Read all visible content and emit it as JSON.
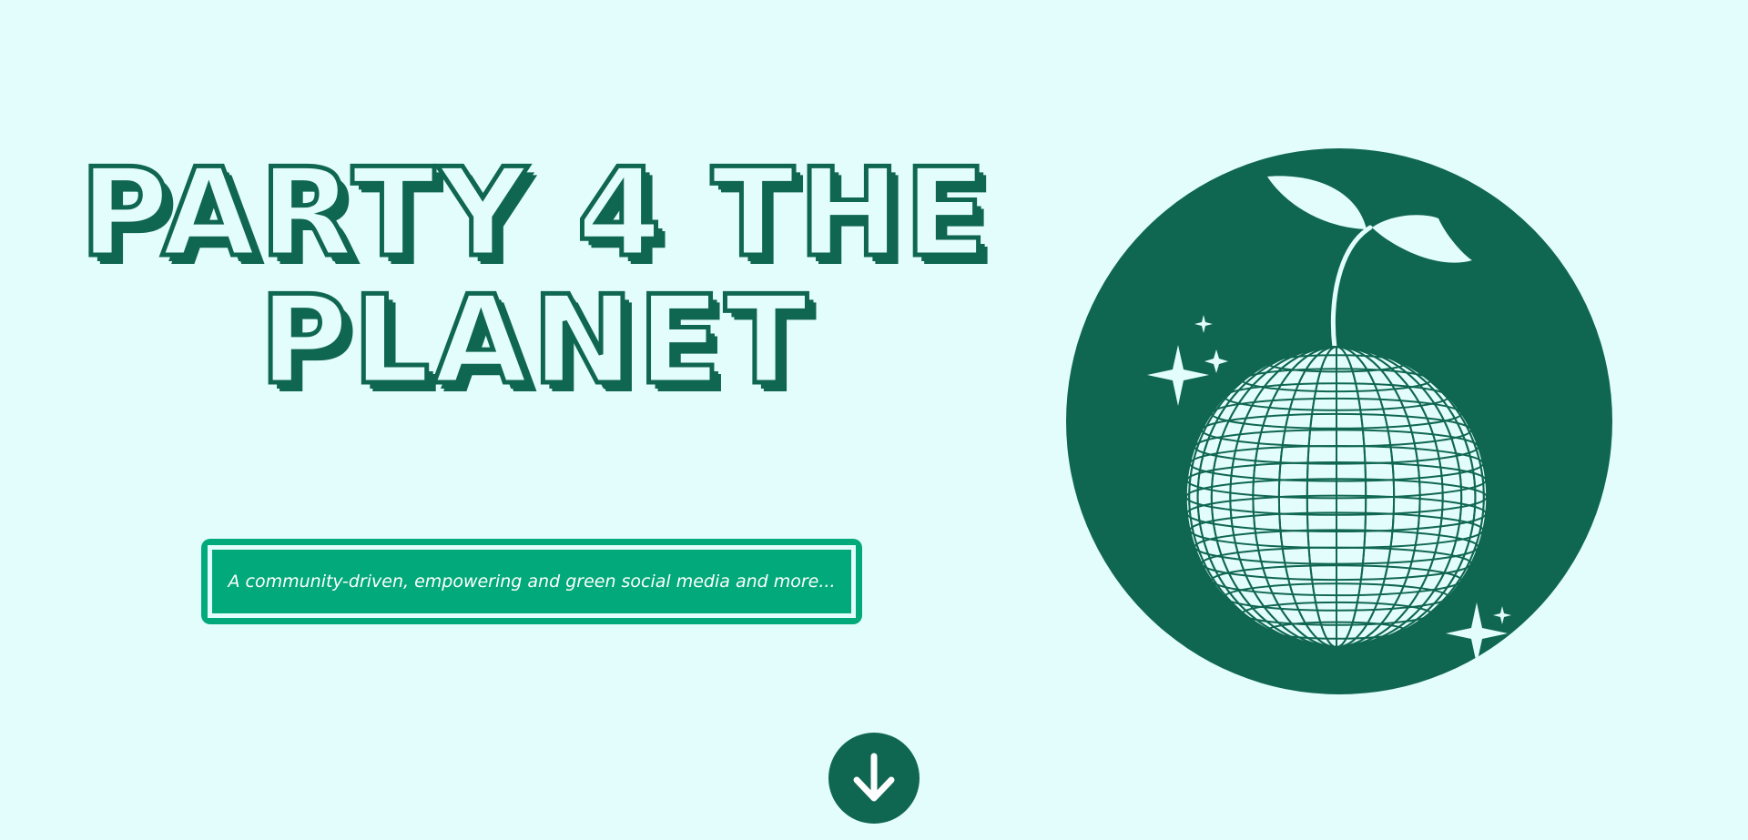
{
  "hero": {
    "title_line1": "PARTY 4 THE",
    "title_line2": "PLANET",
    "tagline": "A community-driven, empowering and green social media and more..."
  },
  "illustration": {
    "icon": "disco-ball-sprout-icon",
    "decorations": [
      "sparkle-icon",
      "sparkle-icon"
    ]
  },
  "scroll_button": {
    "icon": "arrow-down-icon"
  },
  "colors": {
    "background": "#e3fdfd",
    "dark_green": "#106751",
    "accent_green": "#02a97a",
    "white": "#ffffff"
  }
}
